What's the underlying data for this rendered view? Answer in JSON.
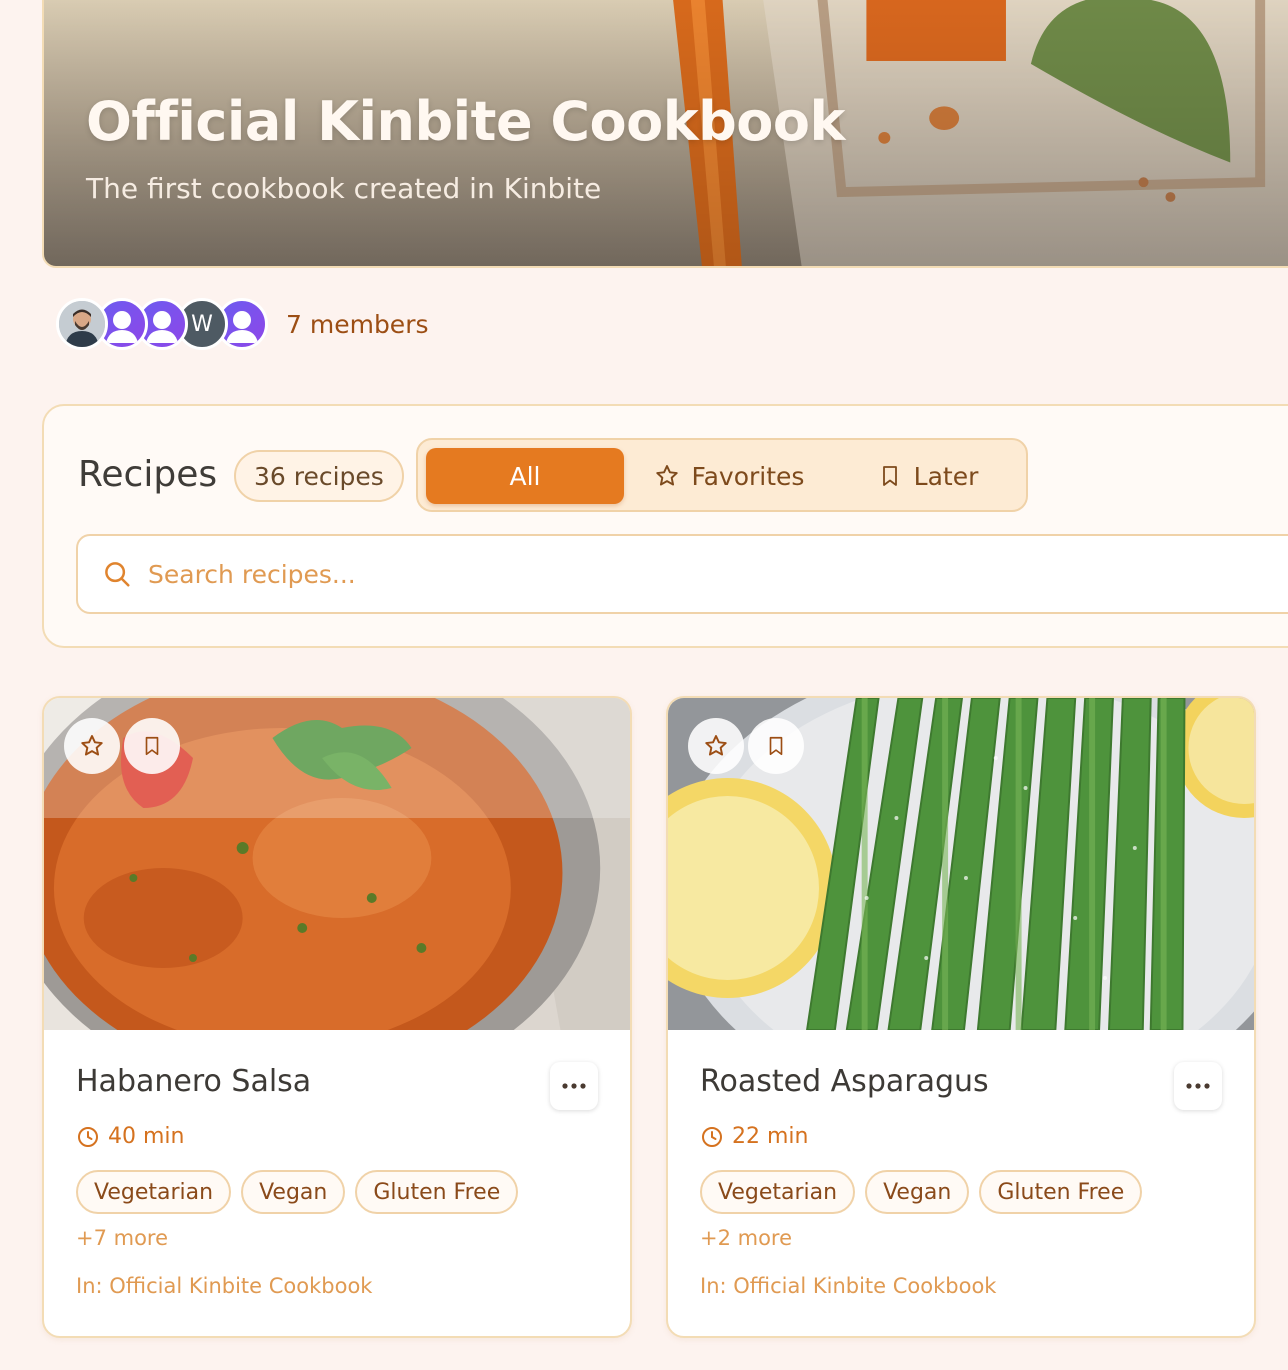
{
  "hero": {
    "title": "Official Kinbite Cookbook",
    "subtitle": "The first cookbook created in Kinbite"
  },
  "members": {
    "count_label": "7 members",
    "avatars": [
      {
        "type": "photo"
      },
      {
        "type": "placeholder"
      },
      {
        "type": "placeholder"
      },
      {
        "type": "initial",
        "initial": "W"
      },
      {
        "type": "placeholder"
      }
    ]
  },
  "recipes_panel": {
    "heading": "Recipes",
    "count_badge": "36 recipes",
    "filters": [
      {
        "label": "All",
        "active": true
      },
      {
        "label": "Favorites",
        "icon": "star-icon",
        "active": false
      },
      {
        "label": "Later",
        "icon": "bookmark-icon",
        "active": false
      }
    ],
    "search": {
      "placeholder": "Search recipes...",
      "value": ""
    }
  },
  "cards": [
    {
      "title": "Habanero Salsa",
      "time": "40 min",
      "tags": [
        "Vegetarian",
        "Vegan",
        "Gluten Free"
      ],
      "more_tags": "+7 more",
      "cookbook": "In: Official Kinbite Cookbook"
    },
    {
      "title": "Roasted Asparagus",
      "time": "22 min",
      "tags": [
        "Vegetarian",
        "Vegan",
        "Gluten Free"
      ],
      "more_tags": "+2 more",
      "cookbook": "In: Official Kinbite Cookbook"
    }
  ],
  "colors": {
    "accent": "#e57a20",
    "page_bg": "#fdf3ef",
    "border": "#f3dcb5",
    "muted_accent": "#e09a52"
  }
}
